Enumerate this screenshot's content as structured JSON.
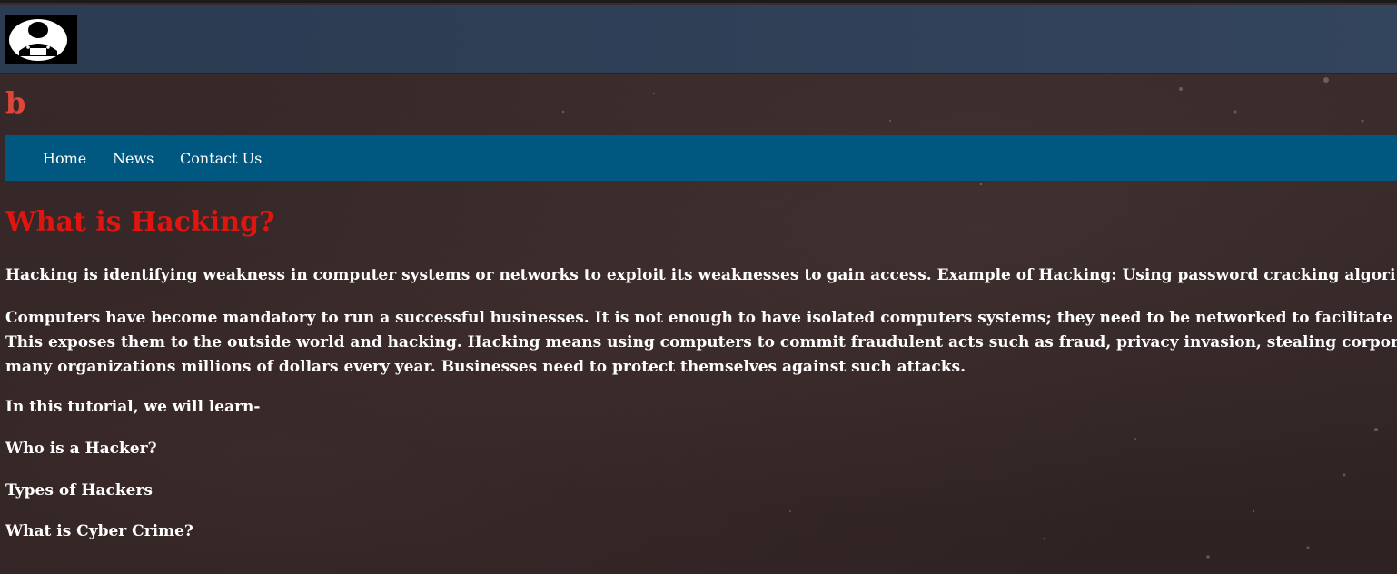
{
  "header": {
    "logo_icon": "hacker-logo-icon",
    "site_title": "b"
  },
  "nav": {
    "items": [
      {
        "label": "Home"
      },
      {
        "label": "News"
      },
      {
        "label": "Contact Us"
      }
    ]
  },
  "article": {
    "title": "What is Hacking?",
    "paragraph1": "Hacking is identifying weakness in computer systems or networks to exploit its weaknesses to gain access. Example of Hacking: Using password cracking algorithm",
    "paragraph2_line1": "Computers have become mandatory to run a successful businesses. It is not enough to have isolated computers systems; they need to be networked to facilitate co",
    "paragraph2_line2": "This exposes them to the outside world and hacking. Hacking means using computers to commit fraudulent acts such as fraud, privacy invasion, stealing corporat",
    "paragraph2_line3": "many organizations millions of dollars every year. Businesses need to protect themselves against such attacks.",
    "intro": "In this tutorial, we will learn-",
    "topics": [
      "Who is a Hacker?",
      "Types of Hackers",
      "What is Cyber Crime?"
    ]
  },
  "colors": {
    "topbar": "#2e3e55",
    "navbar": "#00577f",
    "site_title": "#e0453a",
    "heading": "#e0150f",
    "background": "#332626"
  }
}
